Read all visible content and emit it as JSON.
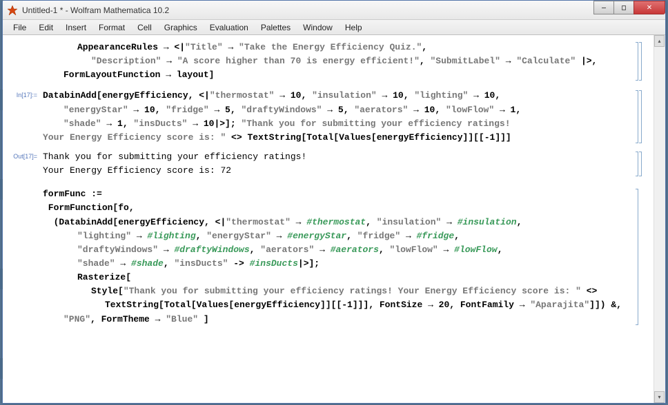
{
  "window": {
    "title": "Untitled-1 * - Wolfram Mathematica 10.2",
    "controls": {
      "min": "—",
      "max": "□",
      "close": "✕"
    }
  },
  "menu": {
    "file": "File",
    "edit": "Edit",
    "insert": "Insert",
    "format": "Format",
    "cell": "Cell",
    "graphics": "Graphics",
    "evaluation": "Evaluation",
    "palettes": "Palettes",
    "window": "Window",
    "help": "Help"
  },
  "scroll": {
    "up": "▴",
    "down": "▾"
  },
  "labels": {
    "in17": "In[17]:=",
    "out17": "Out[17]="
  },
  "pre": {
    "l1a": "AppearanceRules → <|",
    "l1b": "\"Title\"",
    "l1c": " → ",
    "l1d": "\"Take the Energy Efficiency Quiz.\"",
    "l1e": ",",
    "l2a": "\"Description\"",
    "l2b": " → ",
    "l2c": "\"A score higher than 70 is energy efficient!\"",
    "l2d": ", ",
    "l2e": "\"SubmitLabel\"",
    "l2f": " → ",
    "l2g": "\"Calculate\"",
    "l2h": " |>,",
    "l3": "FormLayoutFunction → layout]"
  },
  "in": {
    "l1a": "DatabinAdd[energyEfficiency, <|",
    "l1b": "\"thermostat\"",
    "l1c": " → 10, ",
    "l1d": "\"insulation\"",
    "l1e": " → 10, ",
    "l1f": "\"lighting\"",
    "l1g": " → 10,",
    "l2a": "\"energyStar\"",
    "l2b": " → 10, ",
    "l2c": "\"fridge\"",
    "l2d": " → 5, ",
    "l2e": "\"draftyWindows\"",
    "l2f": " → 5, ",
    "l2g": "\"aerators\"",
    "l2h": " → 10, ",
    "l2i": "\"lowFlow\"",
    "l2j": " → 1,",
    "l3a": "\"shade\"",
    "l3b": " → 1, ",
    "l3c": "\"insDucts\"",
    "l3d": " → 10|>]; ",
    "l3e": "\"Thank you for submitting your efficiency ratings!",
    "l4a": "Your Energy Efficiency score is: \"",
    "l4b": " <> ",
    "l4c": "TextString[Total[Values[energyEfficiency]][[-1]]]"
  },
  "out": {
    "l1": "Thank you for submitting your efficiency ratings!",
    "l2": "Your Energy Efficiency score is: 72"
  },
  "ff": {
    "l1": "formFunc :=",
    "l2": " FormFunction[fo,",
    "l3a": "  (DatabinAdd[energyEfficiency, <|",
    "l3b": "\"thermostat\"",
    "l3c": " → ",
    "l3d": "#thermostat",
    "l3e": ", ",
    "l3f": "\"insulation\"",
    "l3g": " → ",
    "l3h": "#insulation",
    "l3i": ",",
    "l4a": "\"lighting\"",
    "l4b": " → ",
    "l4c": "#lighting",
    "l4d": ", ",
    "l4e": "\"energyStar\"",
    "l4f": " → ",
    "l4g": "#energyStar",
    "l4h": ", ",
    "l4i": "\"fridge\"",
    "l4j": " → ",
    "l4k": "#fridge",
    "l4l": ",",
    "l5a": "\"draftyWindows\"",
    "l5b": " → ",
    "l5c": "#draftyWindows",
    "l5d": ", ",
    "l5e": "\"aerators\"",
    "l5f": " → ",
    "l5g": "#aerators",
    "l5h": ", ",
    "l5i": "\"lowFlow\"",
    "l5j": " → ",
    "l5k": "#lowFlow",
    "l5l": ",",
    "l6a": "\"shade\"",
    "l6b": " → ",
    "l6c": "#shade",
    "l6d": ", ",
    "l6e": "\"insDucts\"",
    "l6f": " -> ",
    "l6g": "#insDucts",
    "l6h": "|>];",
    "l7": "Rasterize[",
    "l8a": "Style[",
    "l8b": "\"Thank you for submitting your efficiency ratings! Your Energy Efficiency score is: \"",
    "l8c": " <>",
    "l9a": "TextString[Total[Values[energyEfficiency]][[-1]]], FontSize → 20, FontFamily → ",
    "l9b": "\"Aparajita\"",
    "l9c": "]]) &,",
    "l10a": "\"PNG\"",
    "l10b": ", FormTheme → ",
    "l10c": "\"Blue\"",
    "l10d": " ]"
  }
}
